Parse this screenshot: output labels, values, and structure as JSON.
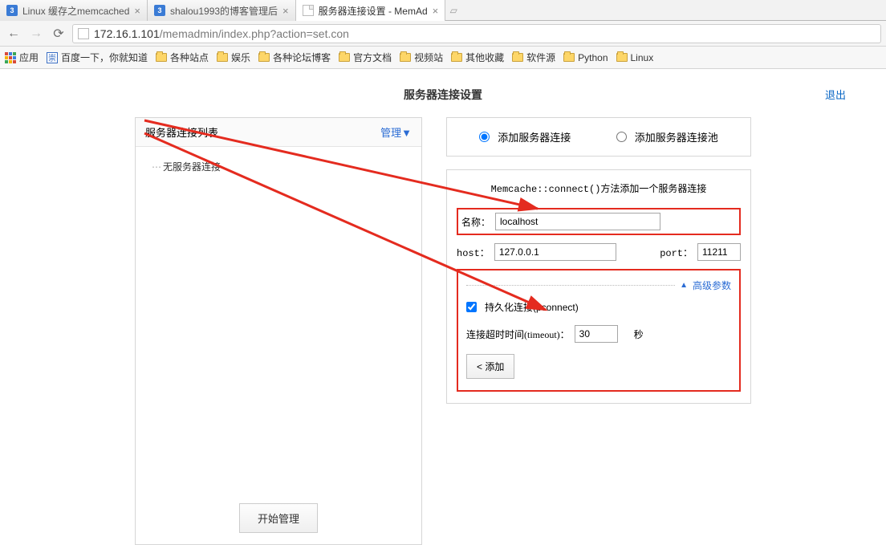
{
  "browser": {
    "tabs": [
      {
        "title": "Linux 缓存之memcached",
        "active": false,
        "icon": "blue"
      },
      {
        "title": "shalou1993的博客管理后",
        "active": false,
        "icon": "blue"
      },
      {
        "title": "服务器连接设置 - MemAd",
        "active": true,
        "icon": "page"
      }
    ],
    "url_host": "172.16.1.101",
    "url_path": "/memadmin/index.php?action=set.con"
  },
  "bookmarks": {
    "apps": "应用",
    "baidu": "百度一下，你就知道",
    "folders": [
      "各种站点",
      "娱乐",
      "各种论坛博客",
      "官方文档",
      "视频站",
      "其他收藏",
      "软件源",
      "Python",
      "Linux"
    ]
  },
  "page": {
    "title": "服务器连接设置",
    "exit": "退出"
  },
  "left": {
    "header": "服务器连接列表",
    "manage": "管理▼",
    "empty": "无服务器连接",
    "start_btn": "开始管理"
  },
  "right": {
    "radio_add_server": "添加服务器连接",
    "radio_add_pool": "添加服务器连接池",
    "method_title": "Memcache::connect()方法添加一个服务器连接",
    "name_label": "名称：",
    "name_value": "localhost",
    "host_label": "host：",
    "host_value": "127.0.0.1",
    "port_label": "port：",
    "port_value": "11211",
    "adv_label": "高级参数",
    "pconnect_label": "持久化连接(pconnect)",
    "timeout_label": "连接超时时间(timeout)：",
    "timeout_value": "30",
    "timeout_unit": "秒",
    "add_btn": "< 添加"
  }
}
